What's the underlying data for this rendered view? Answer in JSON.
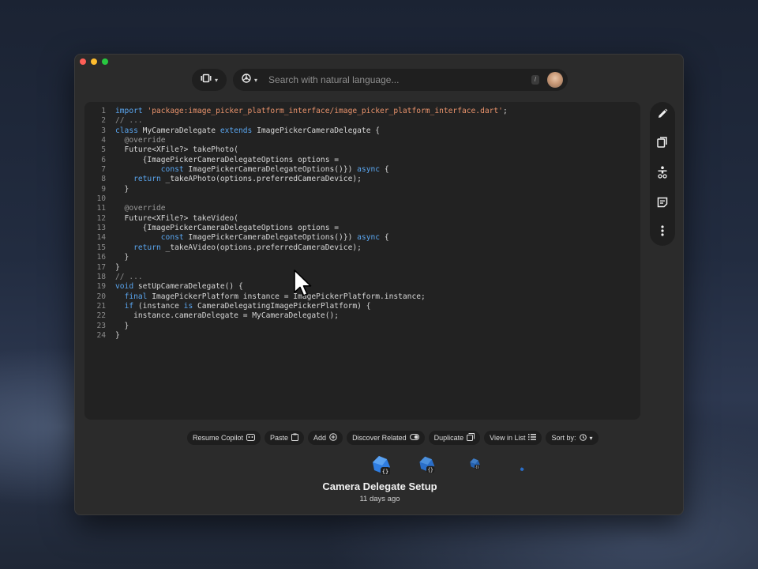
{
  "toolbar": {
    "search_placeholder": "Search with natural language...",
    "slash_hint": "/"
  },
  "editor": {
    "language": "dart",
    "lines": [
      {
        "n": "1",
        "code": "import 'package:image_picker_platform_interface/image_picker_platform_interface.dart';"
      },
      {
        "n": "2",
        "code": "// ..."
      },
      {
        "n": "3",
        "code": "class MyCameraDelegate extends ImagePickerCameraDelegate {"
      },
      {
        "n": "4",
        "code": "  @override"
      },
      {
        "n": "5",
        "code": "  Future<XFile?> takePhoto("
      },
      {
        "n": "6",
        "code": "      {ImagePickerCameraDelegateOptions options ="
      },
      {
        "n": "7",
        "code": "          const ImagePickerCameraDelegateOptions()}) async {"
      },
      {
        "n": "8",
        "code": "    return _takeAPhoto(options.preferredCameraDevice);"
      },
      {
        "n": "9",
        "code": "  }"
      },
      {
        "n": "10",
        "code": ""
      },
      {
        "n": "11",
        "code": "  @override"
      },
      {
        "n": "12",
        "code": "  Future<XFile?> takeVideo("
      },
      {
        "n": "13",
        "code": "      {ImagePickerCameraDelegateOptions options ="
      },
      {
        "n": "14",
        "code": "          const ImagePickerCameraDelegateOptions()}) async {"
      },
      {
        "n": "15",
        "code": "    return _takeAVideo(options.preferredCameraDevice);"
      },
      {
        "n": "16",
        "code": "  }"
      },
      {
        "n": "17",
        "code": "}"
      },
      {
        "n": "18",
        "code": "// ..."
      },
      {
        "n": "19",
        "code": "void setUpCameraDelegate() {"
      },
      {
        "n": "20",
        "code": "  final ImagePickerPlatform instance = ImagePickerPlatform.instance;"
      },
      {
        "n": "21",
        "code": "  if (instance is CameraDelegatingImagePickerPlatform) {"
      },
      {
        "n": "22",
        "code": "    instance.cameraDelegate = MyCameraDelegate();"
      },
      {
        "n": "23",
        "code": "  }"
      },
      {
        "n": "24",
        "code": "}"
      }
    ]
  },
  "side_rail": {
    "icons": [
      "pencil-icon",
      "copy-icon",
      "accessibility-icon",
      "notes-icon",
      "more-vertical-icon"
    ]
  },
  "actions": {
    "resume_copilot": "Resume Copilot",
    "paste": "Paste",
    "add": "Add",
    "discover_related": "Discover Related",
    "duplicate": "Duplicate",
    "view_in_list": "View in List",
    "sort_by": "Sort by:"
  },
  "snippet": {
    "title": "Camera Delegate Setup",
    "age": "11 days ago"
  },
  "colors": {
    "keyword": "#5aa6f0",
    "string": "#e8926b",
    "comment": "#8c8c8c",
    "annotation": "#9a9a9a",
    "plain": "#d7d7d7",
    "accent_blue": "#2f7de1"
  }
}
